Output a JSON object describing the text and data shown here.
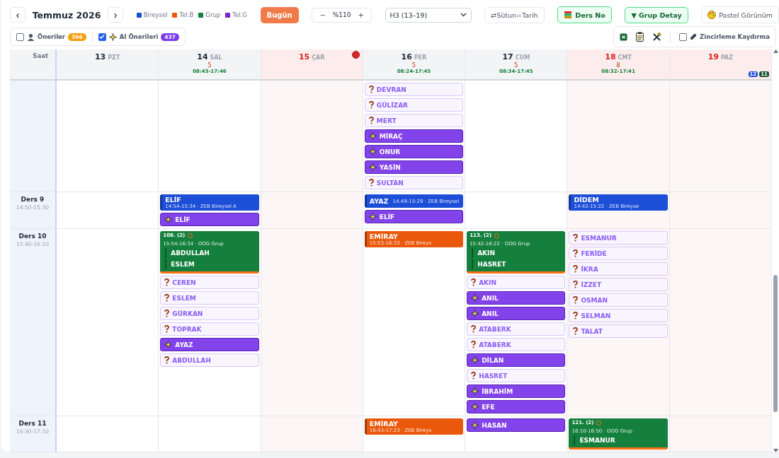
{
  "toolbar": {
    "prev": "‹",
    "title": "Temmuz 2026",
    "next": "›",
    "legend": [
      {
        "label": "Bireysel",
        "color": "#1d4ed8"
      },
      {
        "label": "Tel.B",
        "color": "#ea580c"
      },
      {
        "label": "Grup",
        "color": "#15803d"
      },
      {
        "label": "Tel.G",
        "color": "#7e22ce"
      }
    ],
    "today_button": "Bugün",
    "zoom": {
      "minus": "−",
      "value": "%110",
      "plus": "+"
    },
    "week_select": "H3 (13–19)",
    "toggles": [
      {
        "label": "⇄Sütun=Tarih",
        "on": false
      },
      {
        "label": "Ders No",
        "on": true
      },
      {
        "label": "▼ Grup Detay",
        "on": true
      },
      {
        "label": "Pastel Görünüm",
        "on": false
      }
    ]
  },
  "filters": [
    {
      "label": "Öneriler",
      "checked": false,
      "count": "396",
      "color": "#f59e0b"
    },
    {
      "label": "AI Önerileri",
      "checked": true,
      "count": "437",
      "color": "#7c3aed"
    }
  ],
  "tools": {
    "chain_scroll": {
      "label": "Zincirleme Kaydırma",
      "checked": false
    }
  },
  "grid": {
    "time_header": "Saat",
    "days": [
      {
        "day": "13",
        "name": "PZT",
        "holiday": false,
        "marker": false
      },
      {
        "day": "14",
        "name": "SAL",
        "holiday": false,
        "marker": false,
        "count": "5",
        "hours": "08:43-17:46"
      },
      {
        "day": "15",
        "name": "ÇAR",
        "holiday": true,
        "marker": true
      },
      {
        "day": "16",
        "name": "PER",
        "holiday": false,
        "marker": false,
        "count": "5",
        "hours": "08:24-17:45"
      },
      {
        "day": "17",
        "name": "CUM",
        "holiday": false,
        "marker": false,
        "count": "5",
        "hours": "08:34-17:45"
      },
      {
        "day": "18",
        "name": "CMT",
        "holiday": true,
        "marker": false,
        "count": "8",
        "hours": "08:32-17:41"
      },
      {
        "day": "19",
        "name": "PAZ",
        "holiday": true,
        "marker": false,
        "badges": [
          {
            "text": "12",
            "color": "#1d4ed8"
          },
          {
            "text": "11",
            "color": "#14532d"
          }
        ]
      }
    ],
    "rows": [
      {
        "cells": [
          [],
          [],
          [],
          [
            {
              "kind": "suggestion",
              "name": "DEVRAN"
            },
            {
              "kind": "suggestion",
              "name": "GÜLİZAR"
            },
            {
              "kind": "suggestion",
              "name": "MERT"
            },
            {
              "kind": "ai",
              "name": "MİRAÇ"
            },
            {
              "kind": "ai",
              "name": "ONUR"
            },
            {
              "kind": "ai",
              "name": "YASİN"
            },
            {
              "kind": "suggestion",
              "name": "SULTAN"
            }
          ],
          [],
          [],
          []
        ]
      },
      {
        "label": "Ders 9",
        "time": "14:50-15:30",
        "cells": [
          [],
          [
            {
              "kind": "lesson",
              "name": "ELİF",
              "detail": "14:54-15:34 · ZEB Bireysel A",
              "color": "#1d4ed8"
            },
            {
              "kind": "ai",
              "name": "ELİF"
            }
          ],
          [],
          [
            {
              "kind": "lesson",
              "name": "AYAZ",
              "detail": "14:49-15:29 · ZEB Bireysel",
              "color": "#1d4ed8"
            },
            {
              "kind": "ai",
              "name": "ELİF"
            }
          ],
          [],
          [
            {
              "kind": "lesson",
              "name": "DİDEM",
              "detail": "14:42-15:22 · ZEB Bireyse",
              "color": "#1d4ed8"
            }
          ],
          []
        ]
      },
      {
        "label": "Ders 10",
        "time": "15:40-16:20",
        "cells": [
          [],
          [
            {
              "kind": "group",
              "code": "108. (2)",
              "detail": "15:54-16:34 · OOG Grup",
              "color": "#15803d",
              "members": [
                "ABDULLAH",
                "ESLEM"
              ]
            },
            {
              "kind": "suggestion",
              "name": "CEREN"
            },
            {
              "kind": "suggestion",
              "name": "ESLEM"
            },
            {
              "kind": "suggestion",
              "name": "GÜRKAN"
            },
            {
              "kind": "suggestion",
              "name": "TOPRAK"
            },
            {
              "kind": "ai",
              "name": "AYAZ"
            },
            {
              "kind": "suggestion",
              "name": "ABDULLAH"
            }
          ],
          [],
          [
            {
              "kind": "lesson",
              "name": "EMİRAY",
              "detail": "15:53-16:33 · ZEB Bireys",
              "color": "#ea580c"
            }
          ],
          [
            {
              "kind": "group",
              "code": "113. (2)",
              "detail": "15:42-16:22 · OOG Grup",
              "color": "#15803d",
              "members": [
                "AKIN",
                "HASRET"
              ]
            },
            {
              "kind": "suggestion",
              "name": "AKIN"
            },
            {
              "kind": "ai",
              "name": "ANIL"
            },
            {
              "kind": "ai",
              "name": "ANIL"
            },
            {
              "kind": "suggestion",
              "name": "ATABERK"
            },
            {
              "kind": "suggestion",
              "name": "ATABERK"
            },
            {
              "kind": "ai",
              "name": "DİLAN"
            },
            {
              "kind": "suggestion",
              "name": "HASRET"
            },
            {
              "kind": "ai",
              "name": "İBRAHİM"
            },
            {
              "kind": "ai",
              "name": "EFE"
            }
          ],
          [
            {
              "kind": "suggestion",
              "name": "ESMANUR"
            },
            {
              "kind": "suggestion",
              "name": "FERİDE"
            },
            {
              "kind": "suggestion",
              "name": "İKRA"
            },
            {
              "kind": "suggestion",
              "name": "İZZET"
            },
            {
              "kind": "suggestion",
              "name": "OSMAN"
            },
            {
              "kind": "suggestion",
              "name": "SELMAN"
            },
            {
              "kind": "suggestion",
              "name": "TALAT"
            }
          ],
          []
        ]
      },
      {
        "label": "Ders 11",
        "time": "16:30-17:10",
        "cells": [
          [],
          [],
          [],
          [
            {
              "kind": "lesson",
              "name": "EMİRAY",
              "detail": "16:43-17:23 · ZEB Bireys",
              "color": "#ea580c"
            }
          ],
          [
            {
              "kind": "ai",
              "name": "HASAN"
            }
          ],
          [
            {
              "kind": "group",
              "code": "121. (2)",
              "detail": "16:10-16:50 · OOG Grup",
              "color": "#15803d",
              "members": [
                "ESMANUR"
              ]
            }
          ],
          []
        ]
      }
    ]
  }
}
